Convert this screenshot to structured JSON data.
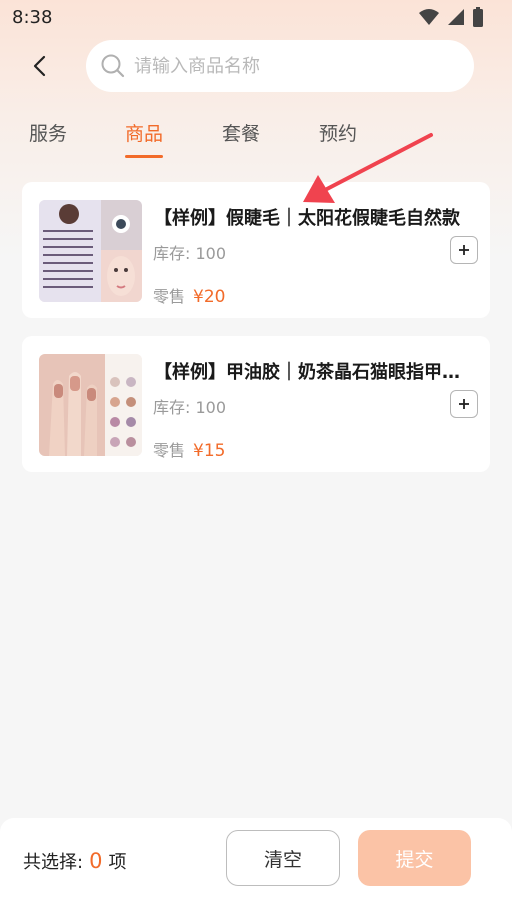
{
  "status_bar": {
    "time": "8:38",
    "icons": [
      "wifi-icon",
      "signal-icon",
      "battery-icon"
    ]
  },
  "search": {
    "placeholder": "请输入商品名称",
    "value": ""
  },
  "tabs": [
    {
      "label": "服务",
      "active": false
    },
    {
      "label": "商品",
      "active": true
    },
    {
      "label": "套餐",
      "active": false
    },
    {
      "label": "预约",
      "active": false
    }
  ],
  "products": [
    {
      "title": "【样例】假睫毛｜太阳花假睫毛自然款",
      "stock_label": "库存:",
      "stock": "100",
      "price_label": "零售",
      "price": "¥20",
      "thumb_icon": "eyelash-product-image"
    },
    {
      "title": "【样例】甲油胶｜奶茶晶石猫眼指甲油胶",
      "stock_label": "库存:",
      "stock": "100",
      "price_label": "零售",
      "price": "¥15",
      "thumb_icon": "nail-polish-product-image"
    }
  ],
  "footer": {
    "selected_prefix": "共选择:",
    "selected_count": "0",
    "selected_suffix": "项",
    "clear_label": "清空",
    "submit_label": "提交"
  },
  "colors": {
    "accent": "#f26b2a",
    "submit_disabled": "#fbc3a6",
    "annotation_arrow": "#f0434f"
  }
}
